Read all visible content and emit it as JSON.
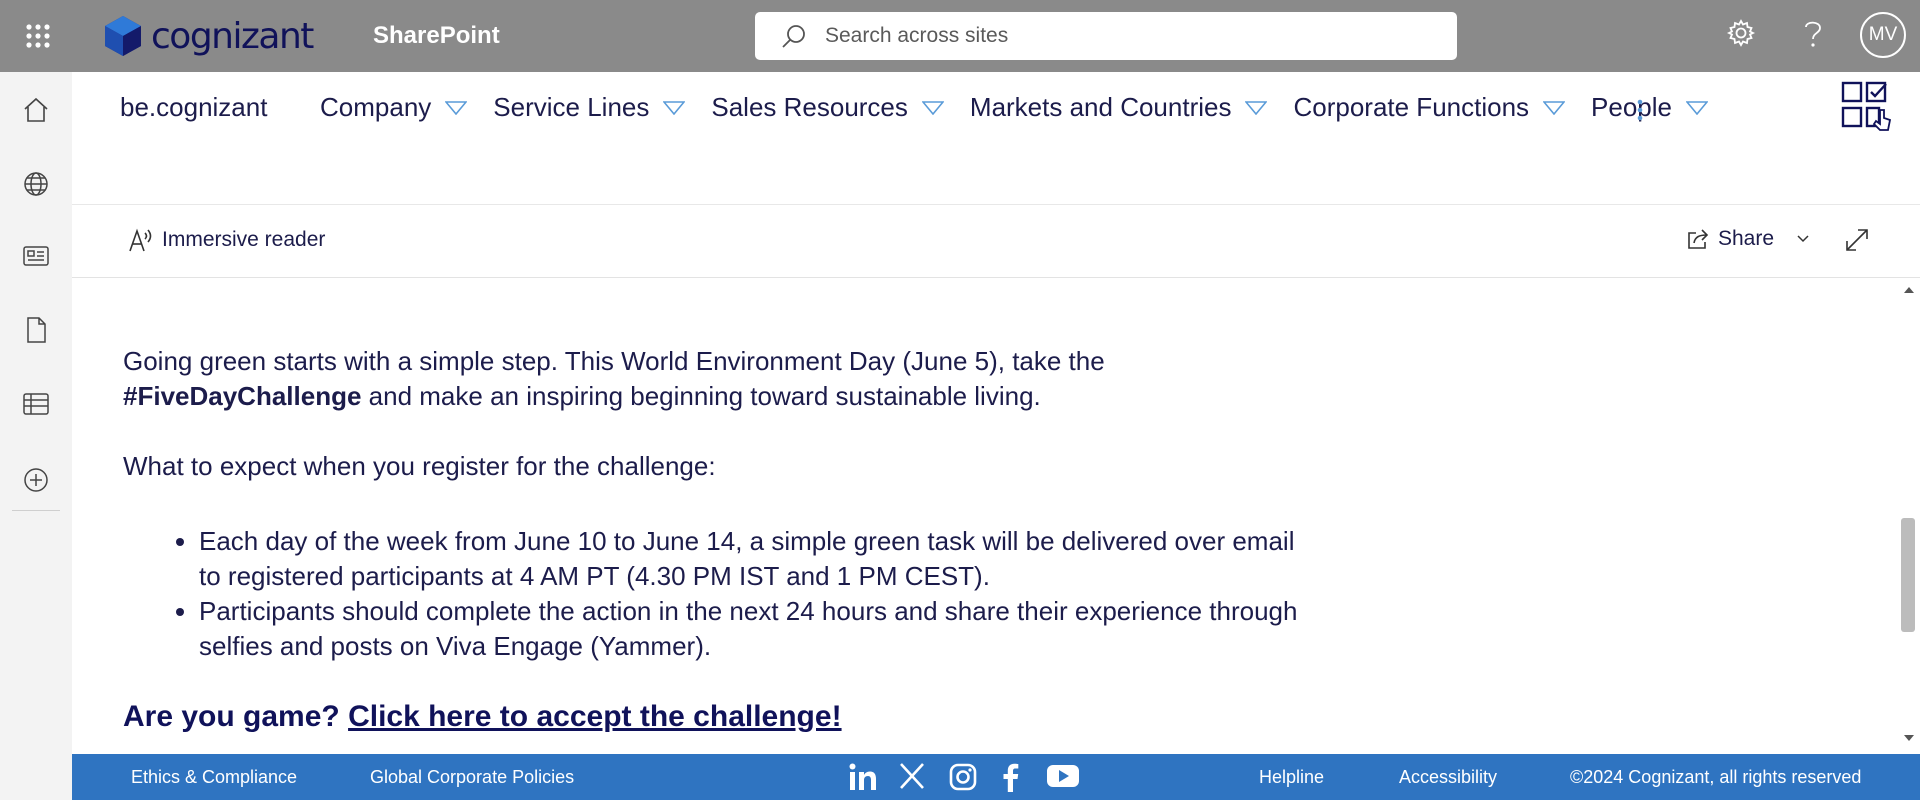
{
  "suite": {
    "brand": "cognizant",
    "app_name": "SharePoint",
    "search_placeholder": "Search across sites",
    "avatar_initials": "MV"
  },
  "site": {
    "title": "be.cognizant",
    "nav": [
      {
        "label": "Company"
      },
      {
        "label": "Service Lines"
      },
      {
        "label": "Sales Resources"
      },
      {
        "label": "Markets and Countries"
      },
      {
        "label": "Corporate Functions"
      },
      {
        "label": "People"
      }
    ],
    "ellipsis": "..."
  },
  "command_bar": {
    "immersive_reader": "Immersive reader",
    "share": "Share"
  },
  "article": {
    "intro_1": "Going green starts with a simple step. This World Environment Day (June 5), take the",
    "intro_hashtag": "#FiveDayChallenge",
    "intro_2": " and make an inspiring beginning toward sustainable living.",
    "expect_heading": "What to expect when you register for the challenge:",
    "bullets": [
      "Each day of the week from June 10 to June 14, a simple green task will be delivered over email to registered participants at 4 AM PT (4.30 PM IST and 1 PM CEST).",
      "Participants should complete the action in the next 24 hours and share their experience through selfies and posts on Viva Engage (Yammer)."
    ],
    "cta_prefix": "Are you game? ",
    "cta_link": "Click here to accept the challenge!"
  },
  "footer": {
    "ethics": "Ethics & Compliance",
    "policies": "Global Corporate Policies",
    "helpline": "Helpline",
    "accessibility": "Accessibility",
    "copyright": "©2024 Cognizant, all rights reserved"
  },
  "colors": {
    "suite_bar": "#8a8a8a",
    "footer": "#2f74c1",
    "text_navy": "#1c1c4b",
    "nav_triangle": "#5a9bd8"
  },
  "icons": {
    "social": [
      "linkedin-icon",
      "x-icon",
      "instagram-icon",
      "facebook-icon",
      "youtube-icon"
    ]
  }
}
